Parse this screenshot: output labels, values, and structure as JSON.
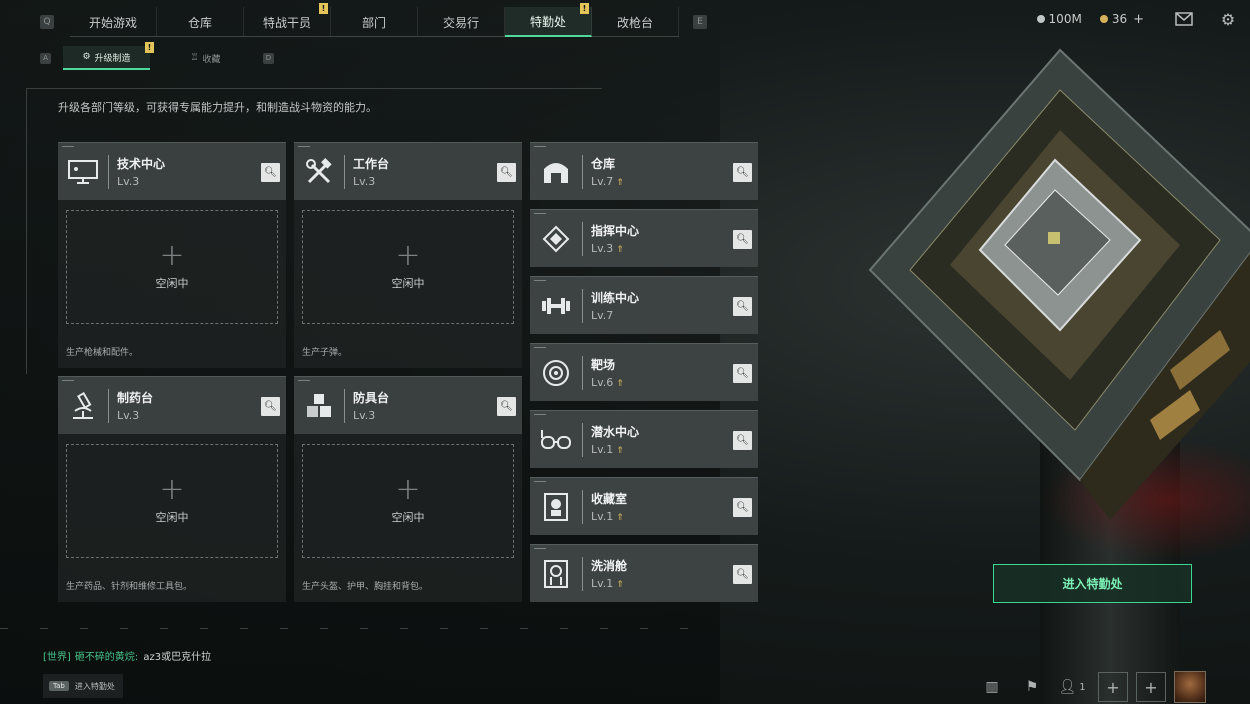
{
  "nav": {
    "left_key": "Q",
    "right_key": "E",
    "tabs": [
      {
        "label": "开始游戏",
        "badge": ""
      },
      {
        "label": "仓库",
        "badge": ""
      },
      {
        "label": "特战干员",
        "badge": "!"
      },
      {
        "label": "部门",
        "badge": ""
      },
      {
        "label": "交易行",
        "badge": ""
      },
      {
        "label": "特勤处",
        "badge": "!",
        "active": true
      },
      {
        "label": "改枪台",
        "badge": ""
      }
    ]
  },
  "currency": {
    "silver": "100M",
    "gold": "36",
    "gold_plus": "+"
  },
  "subnav": {
    "left_key": "A",
    "right_key": "D",
    "tabs": [
      {
        "label": "升级制造",
        "badge": "!",
        "active": true
      },
      {
        "label": "收藏",
        "badge": ""
      }
    ]
  },
  "description": "升级各部门等级，可获得专属能力提升，和制造战斗物资的能力。",
  "workshops": [
    {
      "title": "技术中心",
      "level": "Lv.3",
      "slot_status": "空闲中",
      "footer": "生产枪械和配件。",
      "icon": "computer-icon"
    },
    {
      "title": "工作台",
      "level": "Lv.3",
      "slot_status": "空闲中",
      "footer": "生产子弹。",
      "icon": "tools-icon"
    },
    {
      "title": "制药台",
      "level": "Lv.3",
      "slot_status": "空闲中",
      "footer": "生产药品、针剂和维修工具包。",
      "icon": "microscope-icon"
    },
    {
      "title": "防具台",
      "level": "Lv.3",
      "slot_status": "空闲中",
      "footer": "生产头盔、护甲、胸挂和背包。",
      "icon": "boxes-icon"
    }
  ],
  "departments": [
    {
      "title": "仓库",
      "level": "Lv.7",
      "upgradable": true,
      "icon": "warehouse-icon"
    },
    {
      "title": "指挥中心",
      "level": "Lv.3",
      "upgradable": true,
      "icon": "command-icon"
    },
    {
      "title": "训练中心",
      "level": "Lv.7",
      "upgradable": false,
      "icon": "dumbbell-icon"
    },
    {
      "title": "靶场",
      "level": "Lv.6",
      "upgradable": true,
      "icon": "target-icon"
    },
    {
      "title": "潜水中心",
      "level": "Lv.1",
      "upgradable": true,
      "icon": "diving-mask-icon"
    },
    {
      "title": "收藏室",
      "level": "Lv.1",
      "upgradable": true,
      "icon": "collection-icon"
    },
    {
      "title": "洗消舱",
      "level": "Lv.1",
      "upgradable": true,
      "icon": "decontamination-icon"
    }
  ],
  "enter_button": "进入特勤处",
  "chat": {
    "channel": "[世界]",
    "user": "砸不碎的黄烷:",
    "message": "az3或巴克什拉"
  },
  "tab_hint": {
    "key": "Tab",
    "label": "进入特勤处"
  },
  "team_count": "1",
  "colors": {
    "accent": "#4fd99a",
    "badge": "#e3c55a",
    "upgrade": "#d9b75a"
  }
}
